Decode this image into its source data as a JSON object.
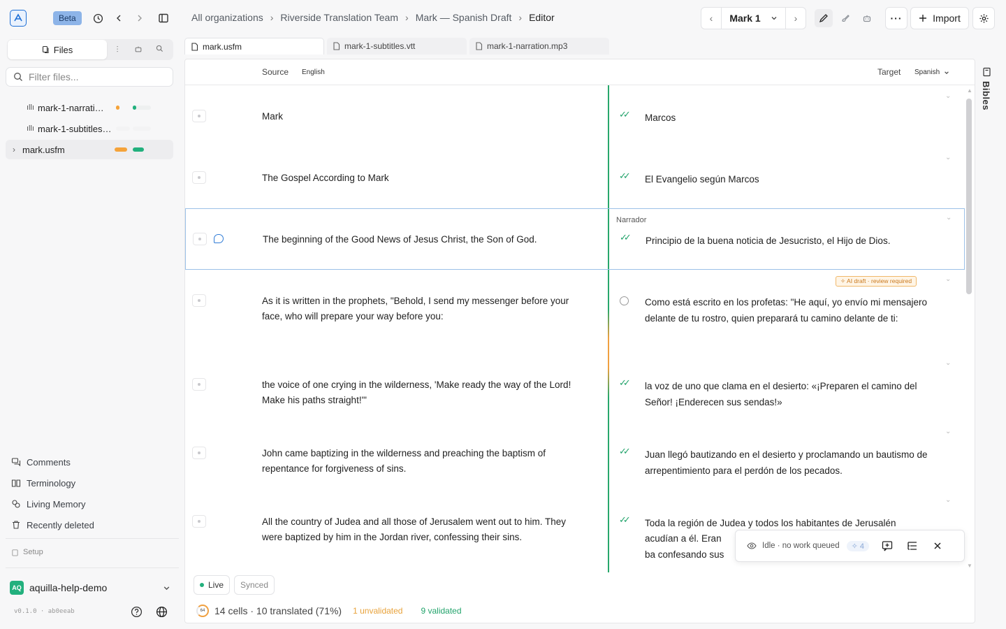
{
  "topbar": {
    "beta_label": "Beta",
    "breadcrumbs": [
      "All organizations",
      "Riverside Translation Team",
      "Mark — Spanish Draft",
      "Editor"
    ],
    "chapter": "Mark 1",
    "import_label": "Import"
  },
  "sidebar": {
    "files_tab": "Files",
    "filter_placeholder": "Filter files...",
    "files": [
      {
        "name": "mark-1-narration.mp3",
        "display": "mark-1-narratio…"
      },
      {
        "name": "mark-1-subtitles.vtt",
        "display": "mark-1-subtitles…"
      },
      {
        "name": "mark.usfm",
        "display": "mark.usfm"
      }
    ],
    "nav": [
      "Comments",
      "Terminology",
      "Living Memory",
      "Recently deleted"
    ],
    "setup_label": "Setup",
    "project": {
      "badge": "AQ",
      "name": "aquilla-help-demo"
    },
    "version": "v0.1.0 · ab0eeab"
  },
  "tabs": [
    {
      "label": "mark.usfm",
      "active": true
    },
    {
      "label": "mark-1-subtitles.vtt",
      "active": false
    },
    {
      "label": "mark-1-narration.mp3",
      "active": false
    }
  ],
  "editor": {
    "source_label": "Source",
    "source_lang": "English",
    "target_label": "Target",
    "target_lang": "Spanish",
    "speaker": "Narrador",
    "ai_badge": "AI draft · review required",
    "rows": [
      {
        "source": "Mark",
        "target": "Marcos",
        "status": "validated"
      },
      {
        "source": "The Gospel According to Mark",
        "target": "El Evangelio según Marcos",
        "status": "validated"
      },
      {
        "source": "The beginning of the Good News of Jesus Christ, the Son of God.",
        "target": "Principio de la buena noticia de Jesucristo, el Hijo de Dios.",
        "status": "validated"
      },
      {
        "source": "As it is written in the prophets, \"Behold, I send my messenger before your face, who will prepare your way before you:",
        "target": "Como está escrito en los profetas: \"He aquí, yo envío mi mensajero delante de tu rostro, quien preparará tu camino delante de ti:",
        "status": "unvalidated"
      },
      {
        "source": "the voice of one crying in the wilderness, 'Make ready the way of the Lord! Make his paths straight!'\"",
        "target": "la voz de uno que clama en el desierto: «¡Preparen el camino del Señor! ¡Enderecen sus sendas!»",
        "status": "validated"
      },
      {
        "source": "John came baptizing in the wilderness and preaching the baptism of repentance for forgiveness of sins.",
        "target": "Juan llegó bautizando en el desierto y proclamando un bautismo de arrepentimiento para el perdón de los pecados.",
        "status": "validated"
      },
      {
        "source": "All the country of Judea and all those of Jerusalem went out to him. They were baptized by him in the Jordan river, confessing their sins.",
        "target": "Toda la región de Judea y todos los habitantes de Jerusalén acudían a él. Eran ba",
        "target_line3": "confesando sus pec",
        "status": "validated"
      }
    ],
    "live_label": "Live",
    "synced_label": "Synced",
    "progress_ring": "64",
    "stats": {
      "summary": "14 cells · 10 translated (71%)",
      "unvalidated": "1 unvalidated",
      "validated": "9 validated"
    },
    "agent": {
      "status": "Idle · no work queued",
      "count": "4"
    }
  },
  "rail": {
    "bibles_label": "Bibles"
  },
  "colors": {
    "accent": "#1d6fd6",
    "validated": "#22a36b",
    "warning": "#e8a23a",
    "orange_bar": "#f5a33a"
  }
}
